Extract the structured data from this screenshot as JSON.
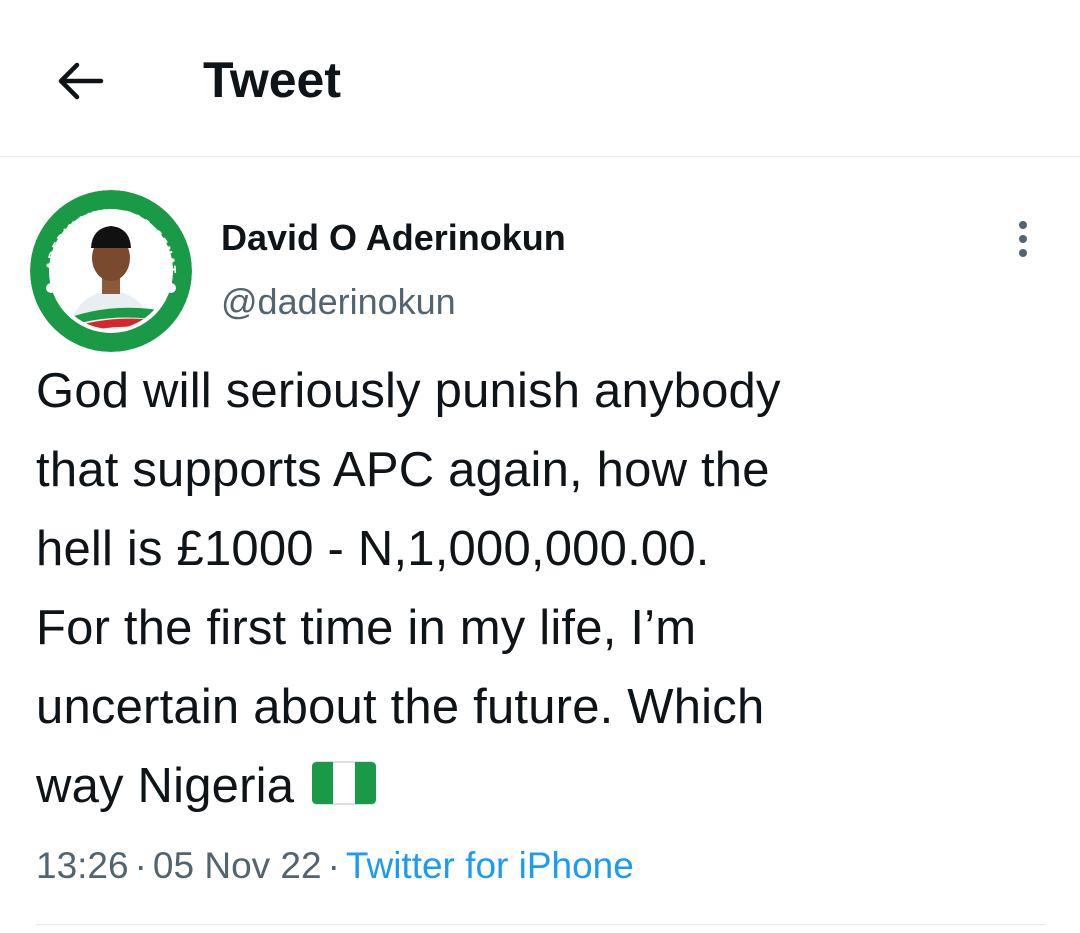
{
  "header": {
    "back_icon": "arrow-left-icon",
    "title": "Tweet"
  },
  "tweet": {
    "author": {
      "display_name": "David O Aderinokun",
      "handle": "@daderinokun",
      "avatar_ring_text": "ADERINOKUN FOR SENATE",
      "avatar_colors": {
        "green": "#1a9a46",
        "red": "#d6252b"
      }
    },
    "more_icon": "more-vertical-icon",
    "text_lines": [
      "God will seriously punish anybody",
      "that supports APC again, how the",
      "hell is £1000 - N,1,000,000.00.",
      "For the first time in my life, I’m",
      "uncertain about the future. Which",
      "way Nigeria"
    ],
    "flag_icon": "nigeria-flag-icon",
    "time": "13:26",
    "date": "05 Nov 22",
    "separator": "·",
    "source": "Twitter for iPhone"
  },
  "colors": {
    "text_primary": "#0f1419",
    "text_secondary": "#536471",
    "link": "#1d9bf0",
    "divider": "#e6e9ec"
  }
}
